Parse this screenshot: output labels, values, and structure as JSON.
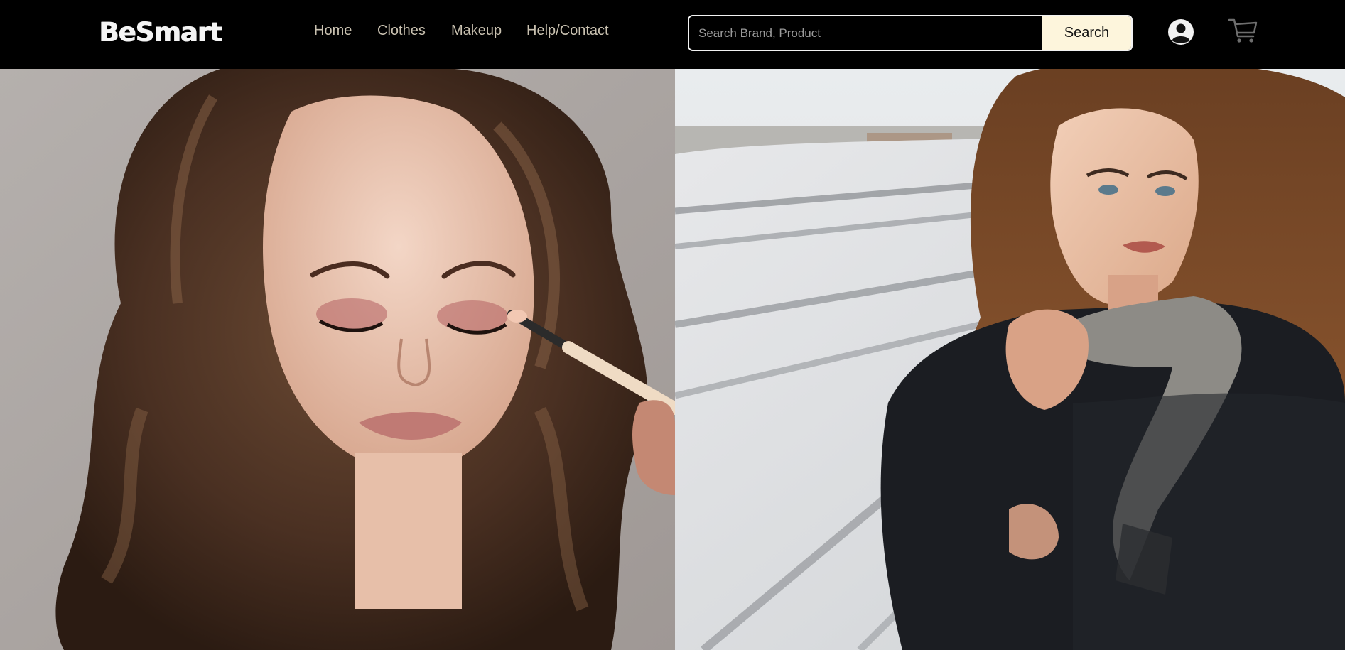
{
  "brand": {
    "logo_text": "BeSmart"
  },
  "nav": {
    "links": [
      {
        "label": "Home"
      },
      {
        "label": "Clothes"
      },
      {
        "label": "Makeup"
      },
      {
        "label": "Help/Contact"
      }
    ]
  },
  "search": {
    "placeholder": "Search Brand, Product",
    "value": "",
    "button_label": "Search"
  },
  "icons": {
    "account": "user-circle-icon",
    "cart": "shopping-cart-icon"
  },
  "colors": {
    "navbar_bg": "#000000",
    "nav_link": "#c9c1b0",
    "search_button_bg": "#fdf5dc"
  },
  "hero": {
    "left_image": "makeup-model-photo",
    "right_image": "winter-clothes-model-photo"
  }
}
